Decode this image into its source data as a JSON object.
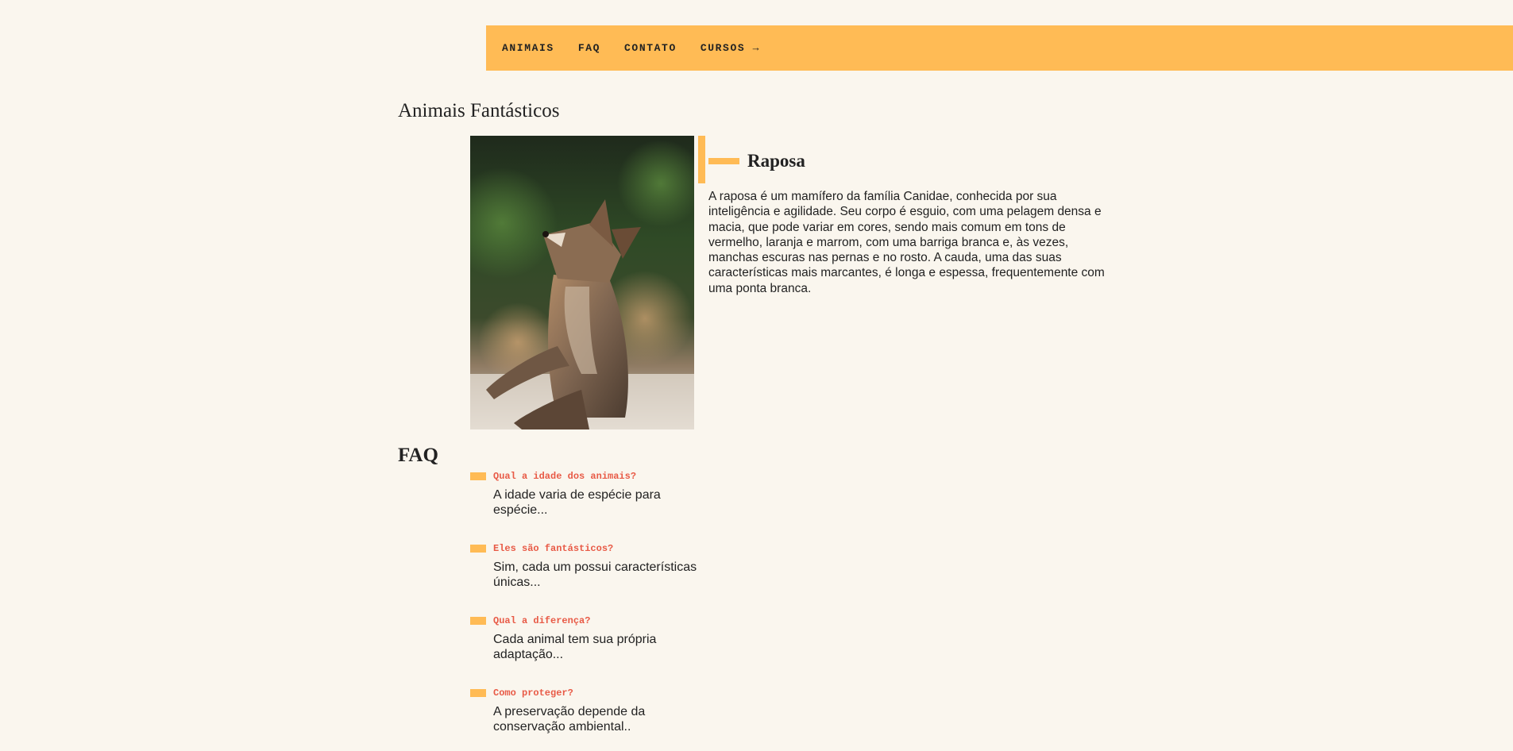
{
  "nav": {
    "items": [
      {
        "label": "ANIMAIS"
      },
      {
        "label": "FAQ"
      },
      {
        "label": "CONTATO"
      },
      {
        "label": "CURSOS →"
      }
    ]
  },
  "page": {
    "title": "Animais Fantásticos"
  },
  "animal": {
    "name": "Raposa",
    "image_subject": "raposa (fox photo)",
    "description": "A raposa é um mamífero da família Canidae, conhecida por sua inteligência e agilidade. Seu corpo é esguio, com uma pelagem densa e macia, que pode variar em cores, sendo mais comum em tons de vermelho, laranja e marrom, com uma barriga branca e, às vezes, manchas escuras nas pernas e no rosto. A cauda, uma das suas características mais marcantes, é longa e espessa, frequentemente com uma ponta branca."
  },
  "faq": {
    "title": "FAQ",
    "items": [
      {
        "question": "Qual a idade dos animais?",
        "answer": "A idade varia de espécie para espécie..."
      },
      {
        "question": "Eles são fantásticos?",
        "answer": "Sim, cada um possui características únicas..."
      },
      {
        "question": "Qual a diferença?",
        "answer": "Cada animal tem sua própria adaptação..."
      },
      {
        "question": "Como proteger?",
        "answer": "A preservação depende da conservação ambiental.."
      }
    ]
  },
  "colors": {
    "background": "#faf6ee",
    "accent": "#ffbb55",
    "question": "#e85a46",
    "text": "#222222"
  }
}
